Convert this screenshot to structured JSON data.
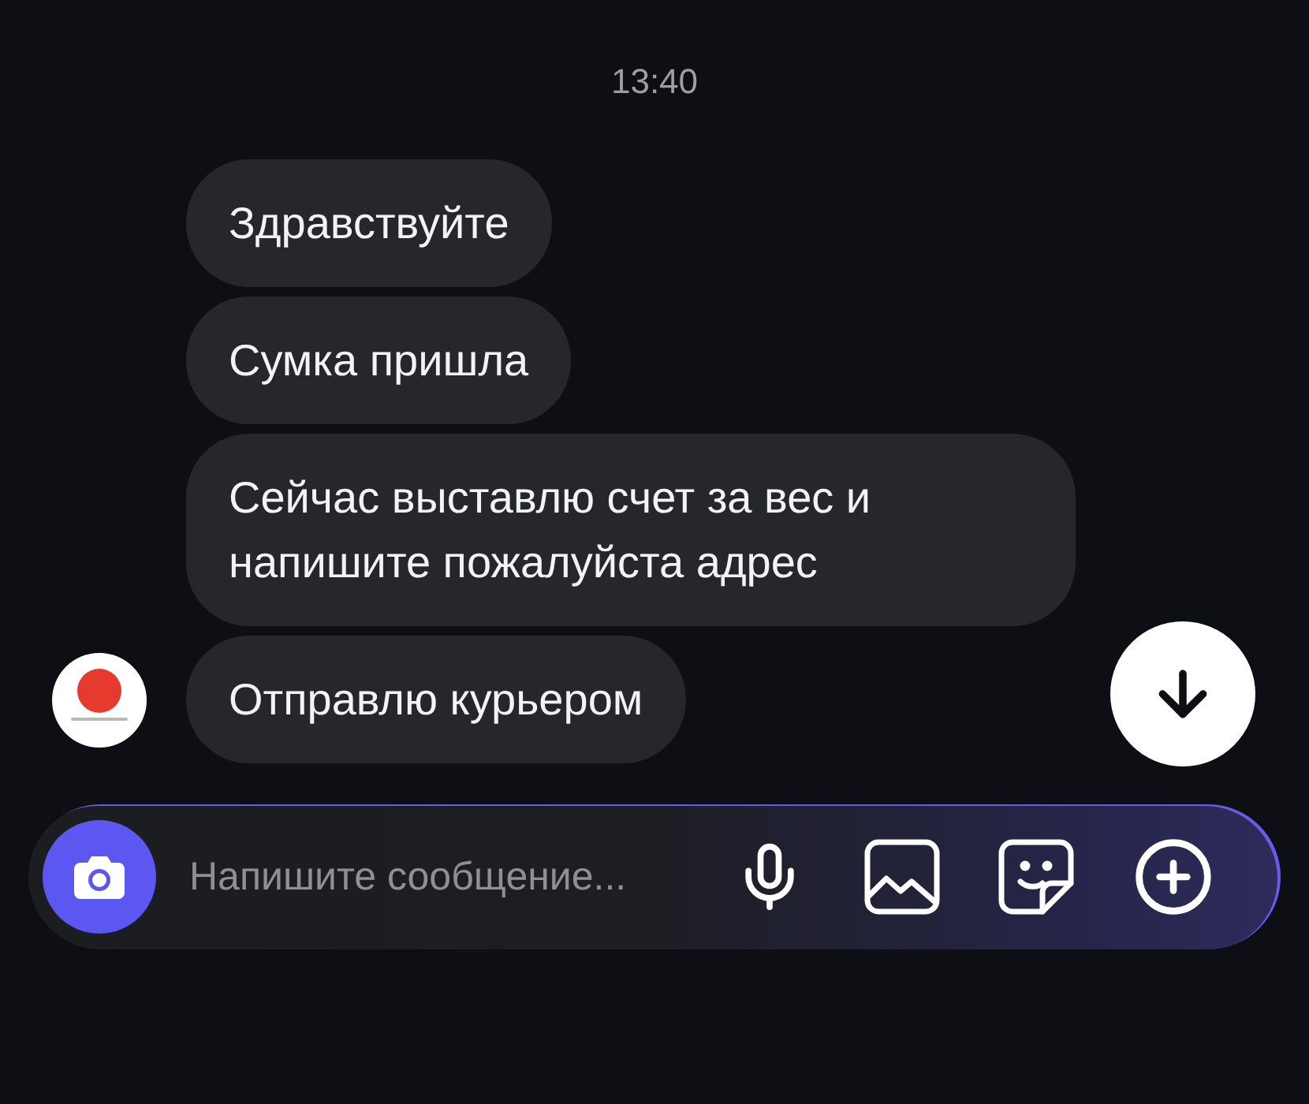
{
  "timestamp": "13:40",
  "messages": [
    {
      "text": "Здравствуйте"
    },
    {
      "text": "Сумка пришла"
    },
    {
      "text": "Сейчас выставлю счет за вес и напишите пожалуйста адрес"
    },
    {
      "text": "Отправлю курьером"
    }
  ],
  "composer": {
    "placeholder": "Напишите сообщение..."
  }
}
